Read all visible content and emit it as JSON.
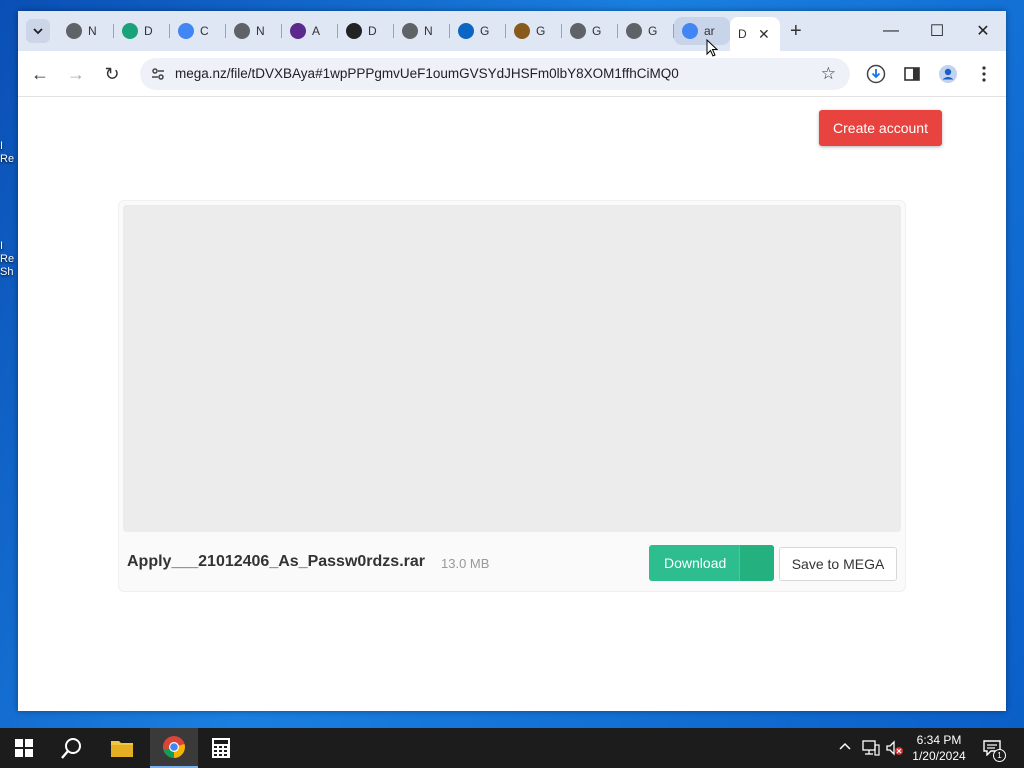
{
  "desktop": {
    "icons": [
      {
        "lines": [
          "I",
          "Re"
        ]
      },
      {
        "lines": [
          "I",
          "Re",
          "Sh"
        ]
      }
    ]
  },
  "browser": {
    "tab_search_icon": "chevron-down-icon",
    "tabs": [
      {
        "label": "N",
        "icon": "chrome-icon",
        "color": "#5f6368"
      },
      {
        "label": "D",
        "icon": "gem-icon",
        "color": "#1aa37a"
      },
      {
        "label": "C",
        "icon": "google-icon",
        "color": "#4285f4"
      },
      {
        "label": "N",
        "icon": "chrome-icon",
        "color": "#5f6368"
      },
      {
        "label": "A",
        "icon": "orb-icon",
        "color": "#5b2a8c"
      },
      {
        "label": "D",
        "icon": "stack-icon",
        "color": "#222222"
      },
      {
        "label": "N",
        "icon": "chrome-icon",
        "color": "#5f6368"
      },
      {
        "label": "G",
        "icon": "linkedin-icon",
        "color": "#0a66c2"
      },
      {
        "label": "G",
        "icon": "hat-icon",
        "color": "#8a5a1c"
      },
      {
        "label": "G",
        "icon": "globe-icon",
        "color": "#5f6368"
      },
      {
        "label": "G",
        "icon": "globe-icon",
        "color": "#5f6368"
      },
      {
        "label": "ar",
        "icon": "google-icon",
        "color": "#4285f4"
      }
    ],
    "active_tab": {
      "label": "D",
      "close": "✕"
    },
    "new_tab": "+",
    "window_controls": {
      "minimize": "—",
      "maximize": "☐",
      "close": "✕"
    },
    "toolbar": {
      "back": "←",
      "forward": "→",
      "reload": "↻",
      "url": "mega.nz/file/tDVXBAya#1wpPPPgmvUeF1oumGVSYdJHSFm0lbY8XOM1ffhCiMQ0",
      "star": "☆"
    }
  },
  "page": {
    "create_account": "Create account",
    "file_name": "Apply___21012406_As_Passw0rdzs.rar",
    "file_size": "13.0 MB",
    "download": "Download",
    "save_to_mega": "Save to MEGA"
  },
  "taskbar": {
    "time": "6:34 PM",
    "date": "1/20/2024",
    "notification_count": "1"
  }
}
